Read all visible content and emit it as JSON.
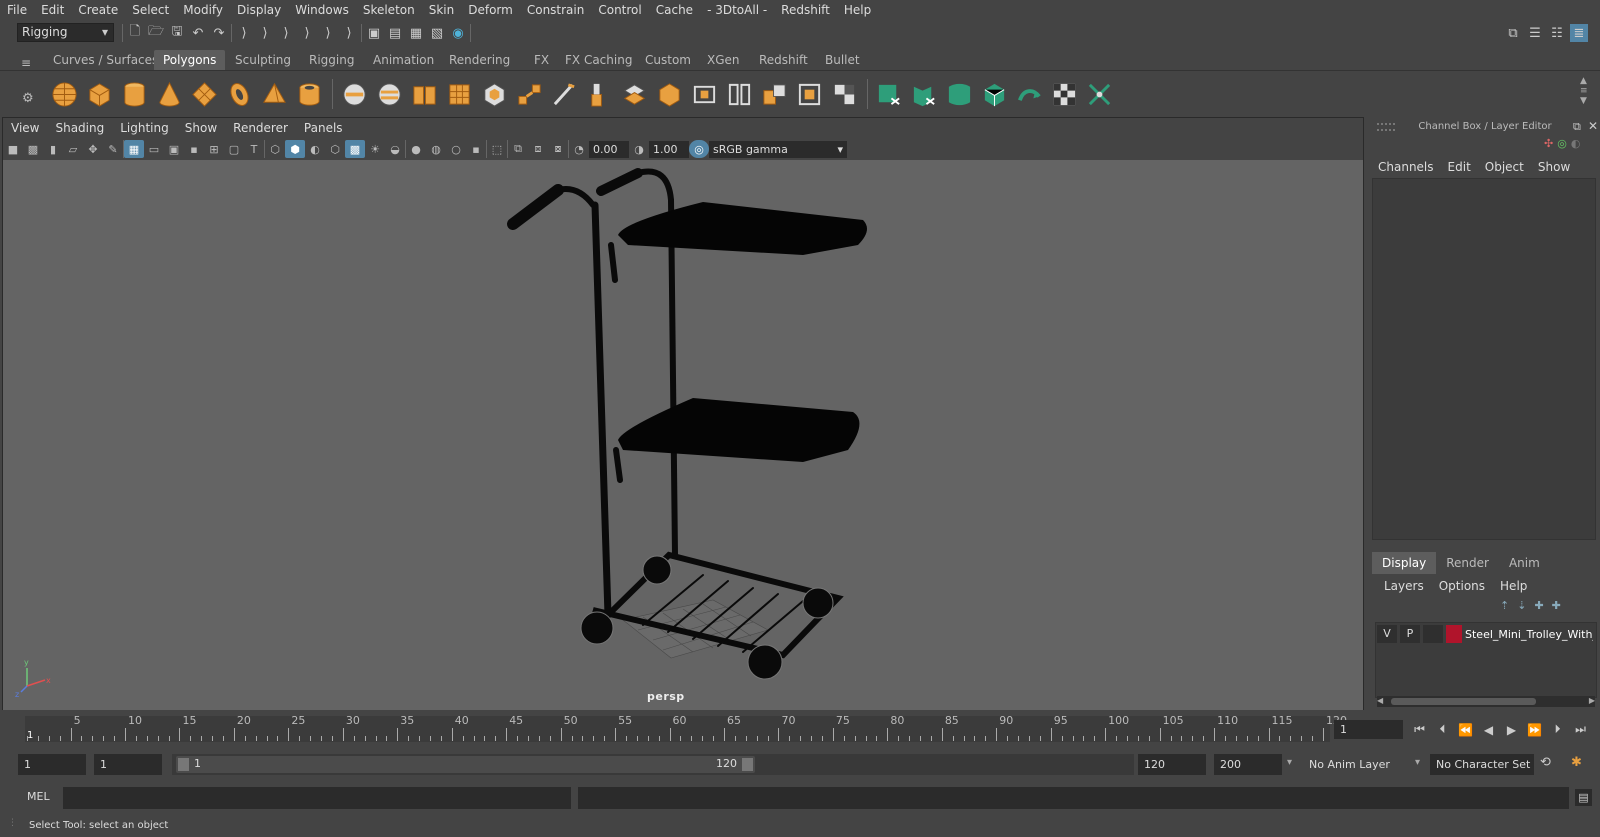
{
  "menubar": [
    "File",
    "Edit",
    "Create",
    "Select",
    "Modify",
    "Display",
    "Windows",
    "Skeleton",
    "Skin",
    "Deform",
    "Constrain",
    "Control",
    "Cache",
    "- 3DtoAll -",
    "Redshift",
    "Help"
  ],
  "mode": "Rigging",
  "shelf_tabs": [
    "Curves / Surfaces",
    "Polygons",
    "Sculpting",
    "Rigging",
    "Animation",
    "Rendering",
    "FX",
    "FX Caching",
    "Custom",
    "XGen",
    "Redshift",
    "Bullet"
  ],
  "active_shelf_tab": "Polygons",
  "viewport": {
    "menu": [
      "View",
      "Shading",
      "Lighting",
      "Show",
      "Renderer",
      "Panels"
    ],
    "exposure": "0.00",
    "gamma": "1.00",
    "color_space": "sRGB gamma",
    "camera": "persp"
  },
  "channel_box": {
    "title": "Channel Box / Layer Editor",
    "menu": [
      "Channels",
      "Edit",
      "Object",
      "Show"
    ]
  },
  "layer_editor": {
    "tabs": [
      "Display",
      "Render",
      "Anim"
    ],
    "active_tab": "Display",
    "menu": [
      "Layers",
      "Options",
      "Help"
    ],
    "layer": {
      "v": "V",
      "p": "P",
      "color": "#b0142b",
      "name": "Steel_Mini_Trolley_With_"
    }
  },
  "timeline": {
    "ticks": [
      "5",
      "10",
      "15",
      "20",
      "25",
      "30",
      "35",
      "40",
      "45",
      "50",
      "55",
      "60",
      "65",
      "70",
      "75",
      "80",
      "85",
      "90",
      "95",
      "100",
      "105",
      "110",
      "115",
      "120"
    ],
    "start_label": "1",
    "current_frame": "1"
  },
  "range": {
    "start": "1",
    "anim_start": "1",
    "slider_start": "1",
    "slider_end": "120",
    "end": "120",
    "anim_end": "200",
    "anim_layer": "No Anim Layer",
    "char_set": "No Character Set"
  },
  "command_line": {
    "lang": "MEL"
  },
  "help_line": "Select Tool: select an object"
}
